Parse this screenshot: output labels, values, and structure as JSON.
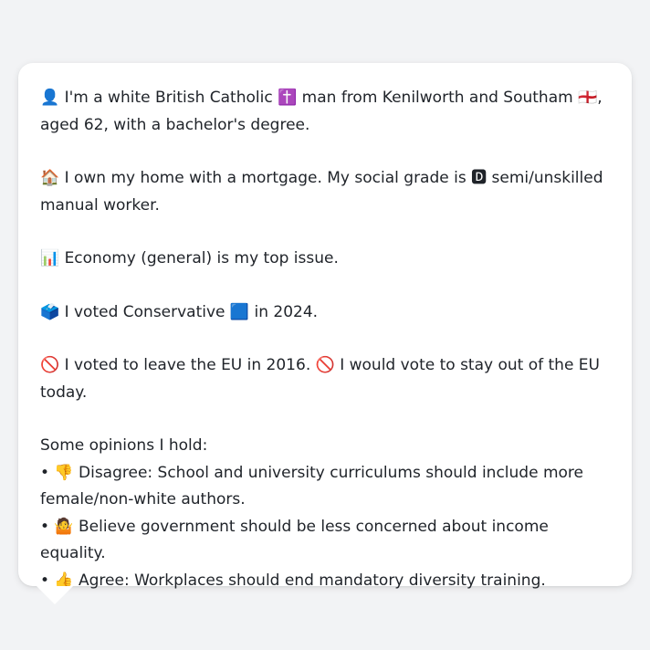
{
  "profile": {
    "intro": "👤 I'm a white British Catholic ✝️ man from Kenilworth and Southam 🏴󠁧󠁢󠁥󠁮󠁧󠁿, aged 62, with a bachelor's degree.",
    "housing": "🏠 I own my home with a mortgage. My social grade is 🅳 semi/unskilled manual worker.",
    "top_issue": "📊 Economy (general) is my top issue.",
    "vote_2024": "🗳️ I voted Conservative 🟦 in 2024.",
    "eu": "🚫 I voted to leave the EU in 2016. 🚫 I would vote to stay out of the EU today."
  },
  "opinions": {
    "heading": "Some opinions I hold:",
    "items": [
      "• 👎 Disagree: School and university curriculums should include more female/non-white authors.",
      "• 🤷 Believe government should be less concerned about income equality.",
      "• 👍 Agree: Workplaces should end mandatory diversity training."
    ]
  },
  "colors": {
    "page_background": "#f2f3f5",
    "card_background": "#ffffff",
    "text": "#1f2329"
  }
}
